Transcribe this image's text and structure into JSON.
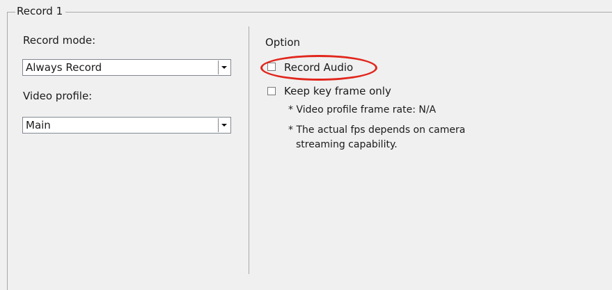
{
  "group": {
    "title": "Record 1"
  },
  "left": {
    "record_mode_label": "Record mode:",
    "record_mode_value": "Always Record",
    "video_profile_label": "Video profile:",
    "video_profile_value": "Main"
  },
  "right": {
    "option_label": "Option",
    "record_audio_label": "Record Audio",
    "record_audio_checked": false,
    "keyframe_label": "Keep key frame only",
    "keyframe_checked": false,
    "note_frame_rate": "* Video profile frame rate: N/A",
    "note_fps_line1": "* The actual fps depends on camera",
    "note_fps_line2": "streaming capability."
  },
  "annotation": {
    "color": "#e1261c",
    "target": "Record Audio"
  },
  "icons": {
    "dropdown": "chevron-down-icon"
  }
}
